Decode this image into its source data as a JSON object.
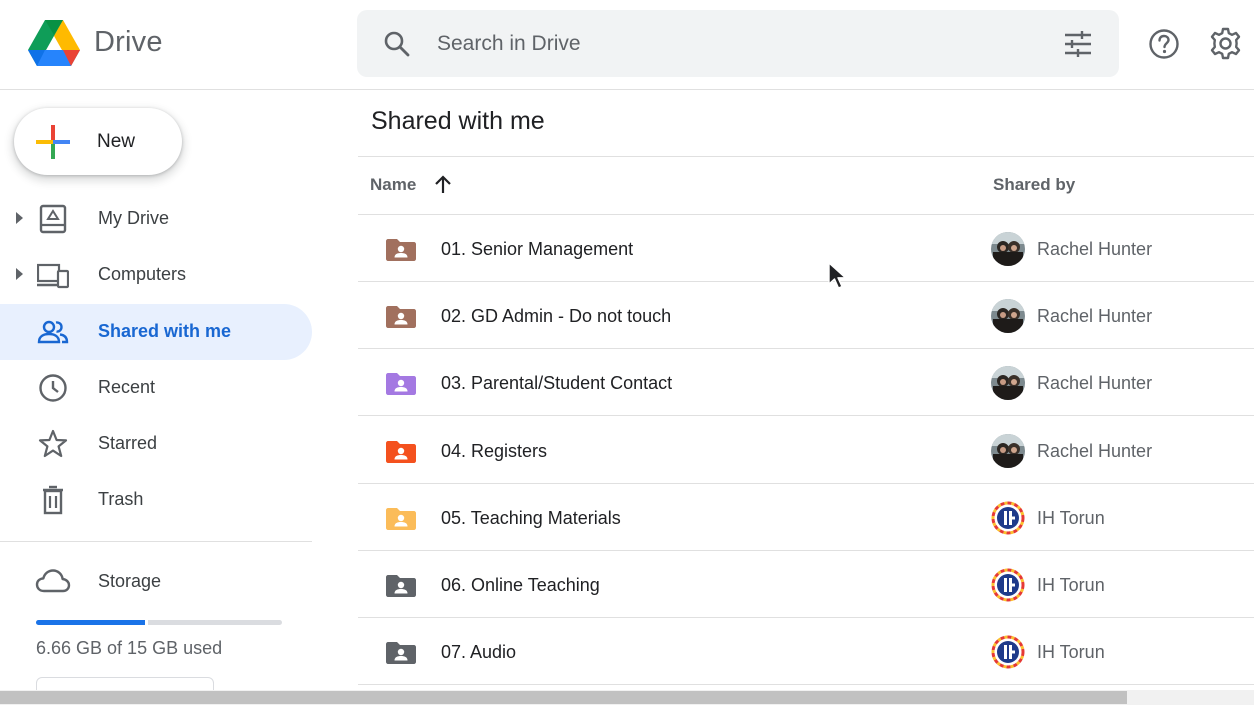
{
  "header": {
    "app_title": "Drive",
    "search_placeholder": "Search in Drive"
  },
  "sidebar": {
    "new_label": "New",
    "items": [
      {
        "label": "My Drive",
        "icon": "my-drive-icon",
        "expandable": true,
        "active": false
      },
      {
        "label": "Computers",
        "icon": "computers-icon",
        "expandable": true,
        "active": false
      },
      {
        "label": "Shared with me",
        "icon": "people-icon",
        "expandable": false,
        "active": true
      },
      {
        "label": "Recent",
        "icon": "clock-icon",
        "expandable": false,
        "active": false
      },
      {
        "label": "Starred",
        "icon": "star-icon",
        "expandable": false,
        "active": false
      },
      {
        "label": "Trash",
        "icon": "trash-icon",
        "expandable": false,
        "active": false
      }
    ],
    "storage": {
      "label": "Storage",
      "used_text": "6.66 GB of 15 GB used",
      "used_fraction": 0.444
    }
  },
  "main": {
    "title": "Shared with me",
    "columns": {
      "name": "Name",
      "shared_by": "Shared by"
    },
    "sort": "name-ascending",
    "rows": [
      {
        "name": "01. Senior Management",
        "owner": "Rachel Hunter",
        "folder_color": "#a1705e",
        "avatar": "photo"
      },
      {
        "name": "02. GD Admin - Do not touch",
        "owner": "Rachel Hunter",
        "folder_color": "#a1705e",
        "avatar": "photo"
      },
      {
        "name": "03. Parental/Student Contact",
        "owner": "Rachel Hunter",
        "folder_color": "#a479e2",
        "avatar": "photo"
      },
      {
        "name": "04. Registers",
        "owner": "Rachel Hunter",
        "folder_color": "#f4511e",
        "avatar": "photo"
      },
      {
        "name": "05. Teaching Materials",
        "owner": "IH Torun",
        "folder_color": "#fbbc59",
        "avatar": "logo"
      },
      {
        "name": "06. Online Teaching",
        "owner": "IH Torun",
        "folder_color": "#5f6368",
        "avatar": "logo"
      },
      {
        "name": "07. Audio",
        "owner": "IH Torun",
        "folder_color": "#5f6368",
        "avatar": "logo"
      }
    ]
  },
  "colors": {
    "accent": "#1a73e8",
    "active_nav_bg": "#e8f0fe",
    "active_nav_text": "#1967d2"
  }
}
